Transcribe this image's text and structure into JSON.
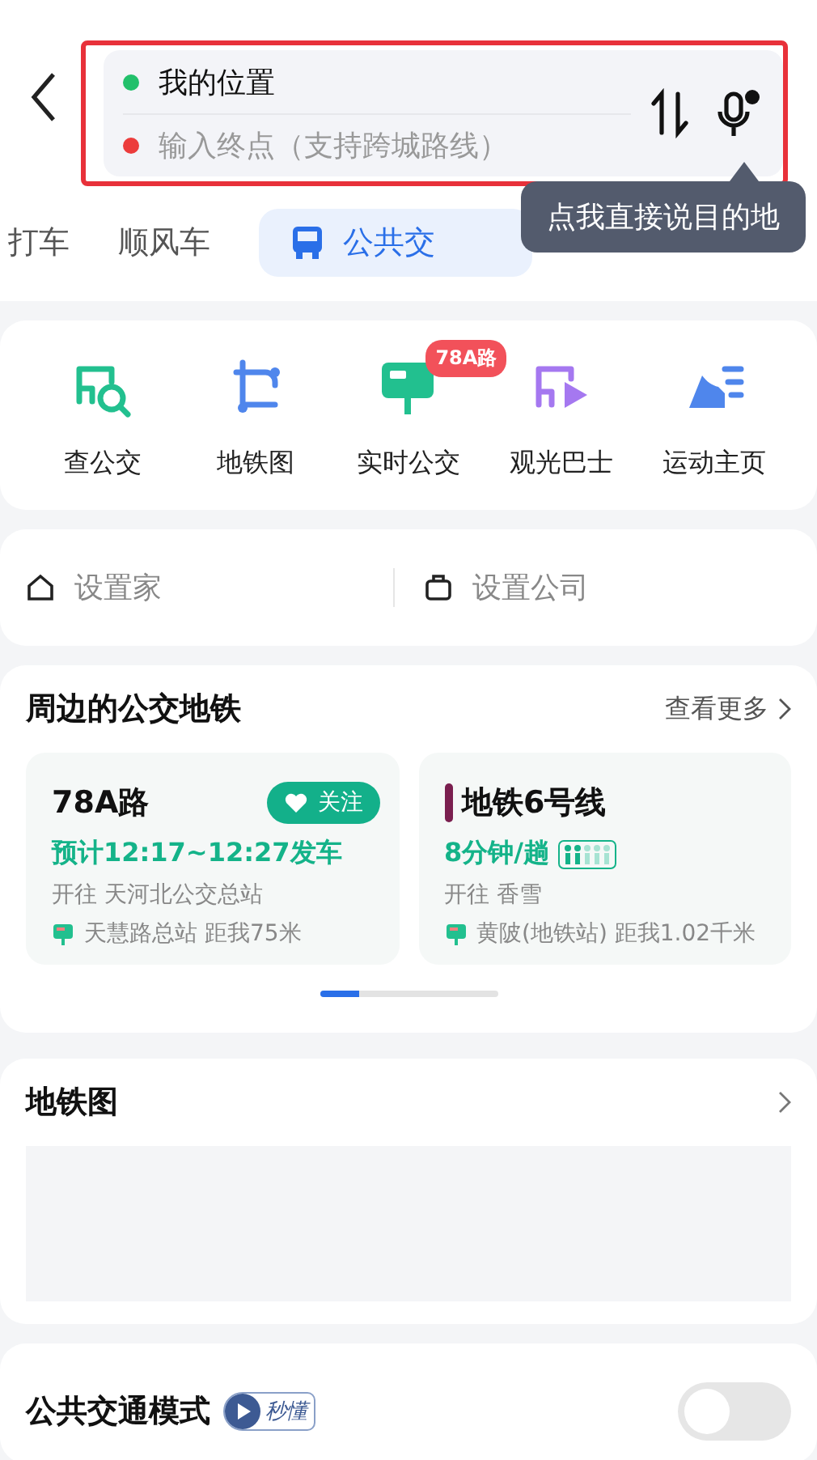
{
  "search": {
    "origin": "我的位置",
    "destination_placeholder": "输入终点（支持跨城路线）"
  },
  "tooltip": "点我直接说目的地",
  "tabs": [
    {
      "label": "打车",
      "selected": false
    },
    {
      "label": "顺风车",
      "selected": false
    },
    {
      "label": "公共交",
      "selected": true
    }
  ],
  "shortcuts": [
    {
      "label": "查公交",
      "kind": "search-bus"
    },
    {
      "label": "地铁图",
      "kind": "subway"
    },
    {
      "label": "实时公交",
      "kind": "realtime",
      "badge": "78A路"
    },
    {
      "label": "观光巴士",
      "kind": "sightseeing"
    },
    {
      "label": "运动主页",
      "kind": "sport"
    }
  ],
  "places": [
    {
      "kind": "home",
      "label": "设置家"
    },
    {
      "kind": "work",
      "label": "设置公司"
    }
  ],
  "nearby": {
    "title": "周边的公交地铁",
    "more": "查看更多",
    "cards": [
      {
        "kind": "bus",
        "name": "78A路",
        "follow": "关注",
        "info": "预计12:17~12:27发车",
        "direction": "开往 天河北公交总站",
        "station": "天慧路总站 距我75米"
      },
      {
        "kind": "metro",
        "name": "地铁6号线",
        "color": "#7a1f4f",
        "info": "8分钟/趟",
        "direction": "开往 香雪",
        "station": "黄陂(地铁站) 距我1.02千米"
      }
    ]
  },
  "subway_map": {
    "title": "地铁图"
  },
  "transit_mode": {
    "title": "公共交通模式",
    "badge": "秒懂",
    "on": false
  }
}
